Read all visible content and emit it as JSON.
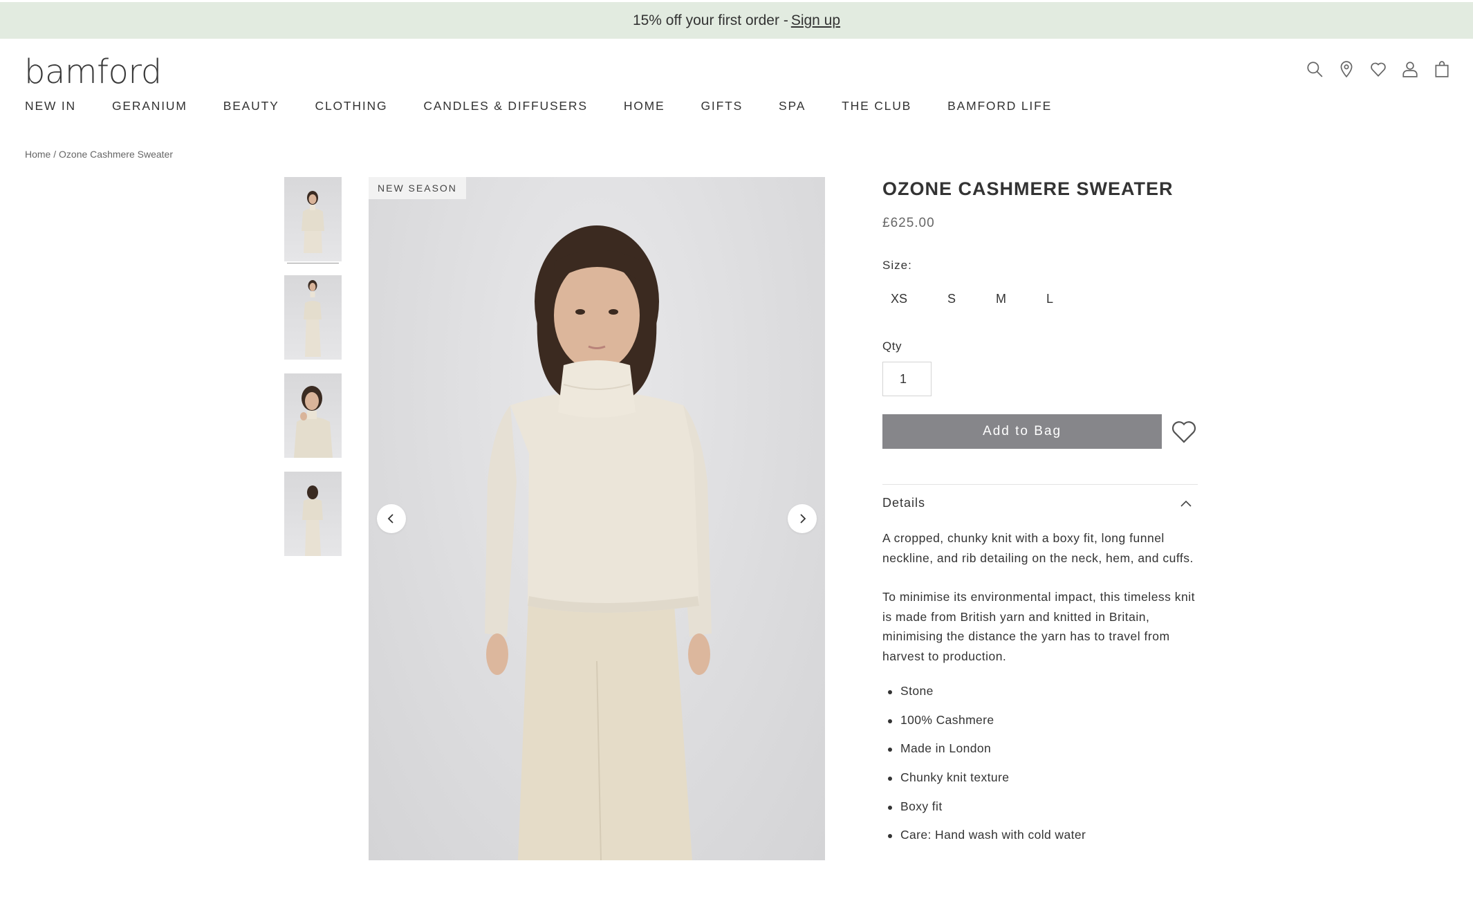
{
  "promo": {
    "text": "15% off your first order - ",
    "link": "Sign up"
  },
  "header": {
    "logo": "bamford",
    "icons": [
      "search-icon",
      "location-pin-icon",
      "heart-icon",
      "user-icon",
      "shopping-bag-icon"
    ]
  },
  "nav": {
    "items": [
      "NEW IN",
      "GERANIUM",
      "BEAUTY",
      "CLOTHING",
      "CANDLES & DIFFUSERS",
      "HOME",
      "GIFTS",
      "SPA",
      "THE CLUB",
      "BAMFORD LIFE"
    ]
  },
  "breadcrumb": {
    "home": "Home",
    "separator": " / ",
    "current": "Ozone Cashmere Sweater"
  },
  "gallery": {
    "badge": "NEW SEASON",
    "thumbnail_count": 4,
    "active_thumbnail": 1,
    "prev_icon": "chevron-left-icon",
    "next_icon": "chevron-right-icon"
  },
  "product": {
    "title": "OZONE CASHMERE SWEATER",
    "price": "£625.00",
    "size_label": "Size:",
    "sizes": [
      "XS",
      "S",
      "M",
      "L"
    ],
    "qty_label": "Qty",
    "qty_value": "1",
    "add_to_bag": "Add to Bag",
    "wishlist_icon": "heart-icon",
    "details_label": "Details",
    "details_icon": "chevron-up-icon",
    "description_1": "A cropped, chunky knit with a boxy fit, long funnel neckline, and rib detailing on the neck, hem, and cuffs.",
    "description_2": "To minimise its environmental impact, this timeless knit is made from British yarn and knitted in Britain, minimising the distance the yarn has to travel from harvest to production.",
    "bullets": [
      "Stone",
      "100% Cashmere",
      "Made in London",
      "Chunky knit texture",
      "Boxy fit",
      "Care: Hand wash with cold water"
    ]
  },
  "colors": {
    "promo_bg": "#e2ebe0",
    "button_bg": "#86868a",
    "text": "#333333"
  }
}
